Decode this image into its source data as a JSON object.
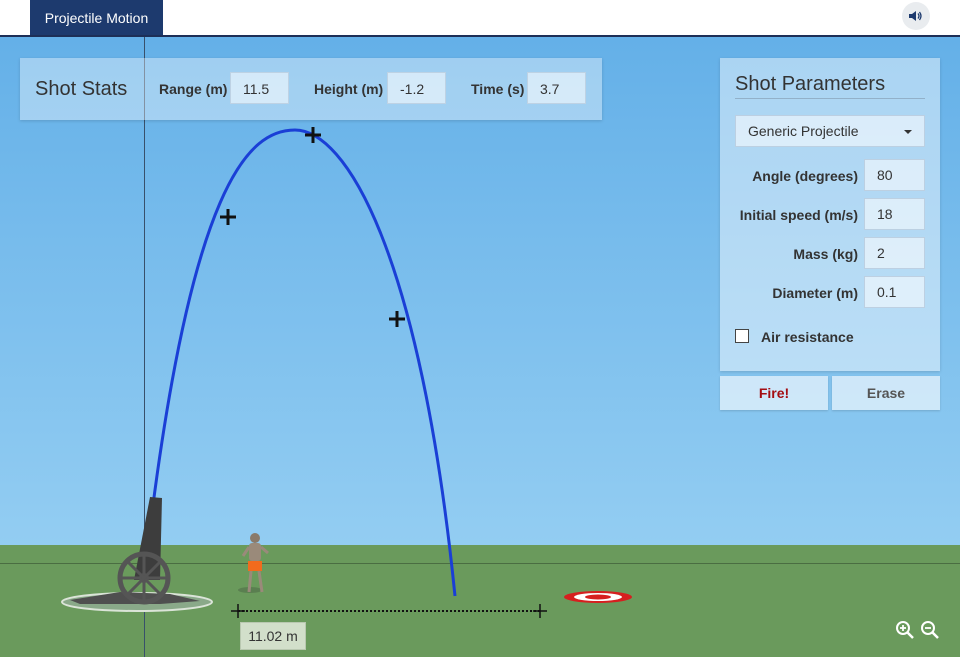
{
  "app": {
    "tab_title": "Projectile Motion",
    "sound_icon": "speaker-icon"
  },
  "stats": {
    "title": "Shot Stats",
    "range_label": "Range (m)",
    "range_value": "11.5",
    "height_label": "Height (m)",
    "height_value": "-1.2",
    "time_label": "Time (s)",
    "time_value": "3.7"
  },
  "params": {
    "title": "Shot Parameters",
    "projectile_selected": "Generic Projectile",
    "angle_label": "Angle (degrees)",
    "angle_value": "80",
    "speed_label": "Initial speed (m/s)",
    "speed_value": "18",
    "mass_label": "Mass (kg)",
    "mass_value": "2",
    "diameter_label": "Diameter (m)",
    "diameter_value": "0.1",
    "air_resistance_label": "Air resistance",
    "air_resistance_checked": false
  },
  "buttons": {
    "fire_label": "Fire!",
    "erase_label": "Erase"
  },
  "measure": {
    "distance_label": "11.02 m"
  },
  "colors": {
    "trajectory": "#1a3fd6",
    "target_red": "#d61f1f",
    "accent_nav": "#1d3a6e"
  }
}
